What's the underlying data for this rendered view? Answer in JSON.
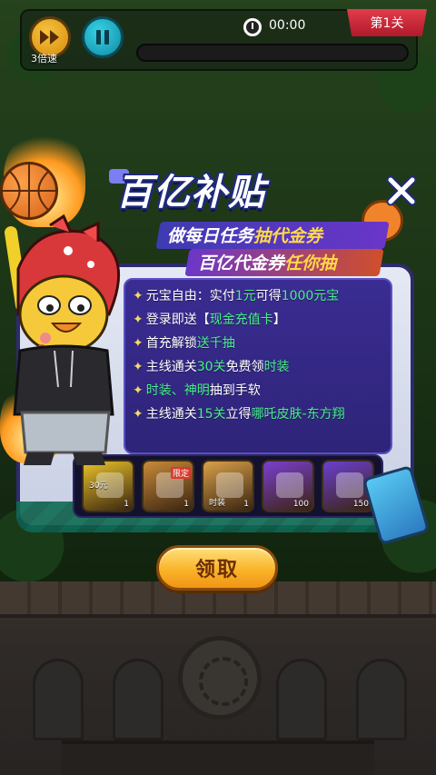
{
  "hud": {
    "speed_label": "3倍速",
    "timer": "00:00",
    "level": "第1关"
  },
  "popup": {
    "headline": "百亿补贴",
    "sub1_plain": "做每日任务",
    "sub1_gold": "抽代金券",
    "sub2_plain": "百亿代金券",
    "sub2_gold": "任你抽",
    "items": [
      {
        "parts": [
          {
            "t": "元宝自由：实付"
          },
          {
            "t": "1元",
            "hl": true
          },
          {
            "t": "可得"
          },
          {
            "t": "1000元宝",
            "hl": true
          }
        ]
      },
      {
        "parts": [
          {
            "t": "登录即送【"
          },
          {
            "t": "现金充值卡",
            "hl": true
          },
          {
            "t": "】"
          }
        ]
      },
      {
        "parts": [
          {
            "t": "首充解锁"
          },
          {
            "t": "送千抽",
            "hl": true
          }
        ]
      },
      {
        "parts": [
          {
            "t": "主线通关"
          },
          {
            "t": "30关",
            "hl": true
          },
          {
            "t": "免费领"
          },
          {
            "t": "时装",
            "hl": true
          }
        ]
      },
      {
        "parts": [
          {
            "t": "时装、神明",
            "hl": true
          },
          {
            "t": "抽到手软"
          }
        ]
      },
      {
        "parts": [
          {
            "t": "主线通关"
          },
          {
            "t": "15关",
            "hl": true
          },
          {
            "t": "立得"
          },
          {
            "t": "哪吒皮肤-东方翔",
            "hl": true
          }
        ]
      }
    ],
    "rewards": [
      {
        "name": "cash-voucher",
        "label": "30元",
        "count": "1",
        "color": "#e8c22a"
      },
      {
        "name": "limited-skin",
        "tag": "限定",
        "count": "1",
        "color": "#c88a3a"
      },
      {
        "name": "costume",
        "sub": "时装",
        "count": "1",
        "color": "#d9a04a"
      },
      {
        "name": "gold-ingot",
        "count": "100",
        "color": "#7b3fd1"
      },
      {
        "name": "puzzle-piece",
        "count": "150",
        "color": "#6b3fd1"
      }
    ],
    "claim_label": "领取"
  }
}
